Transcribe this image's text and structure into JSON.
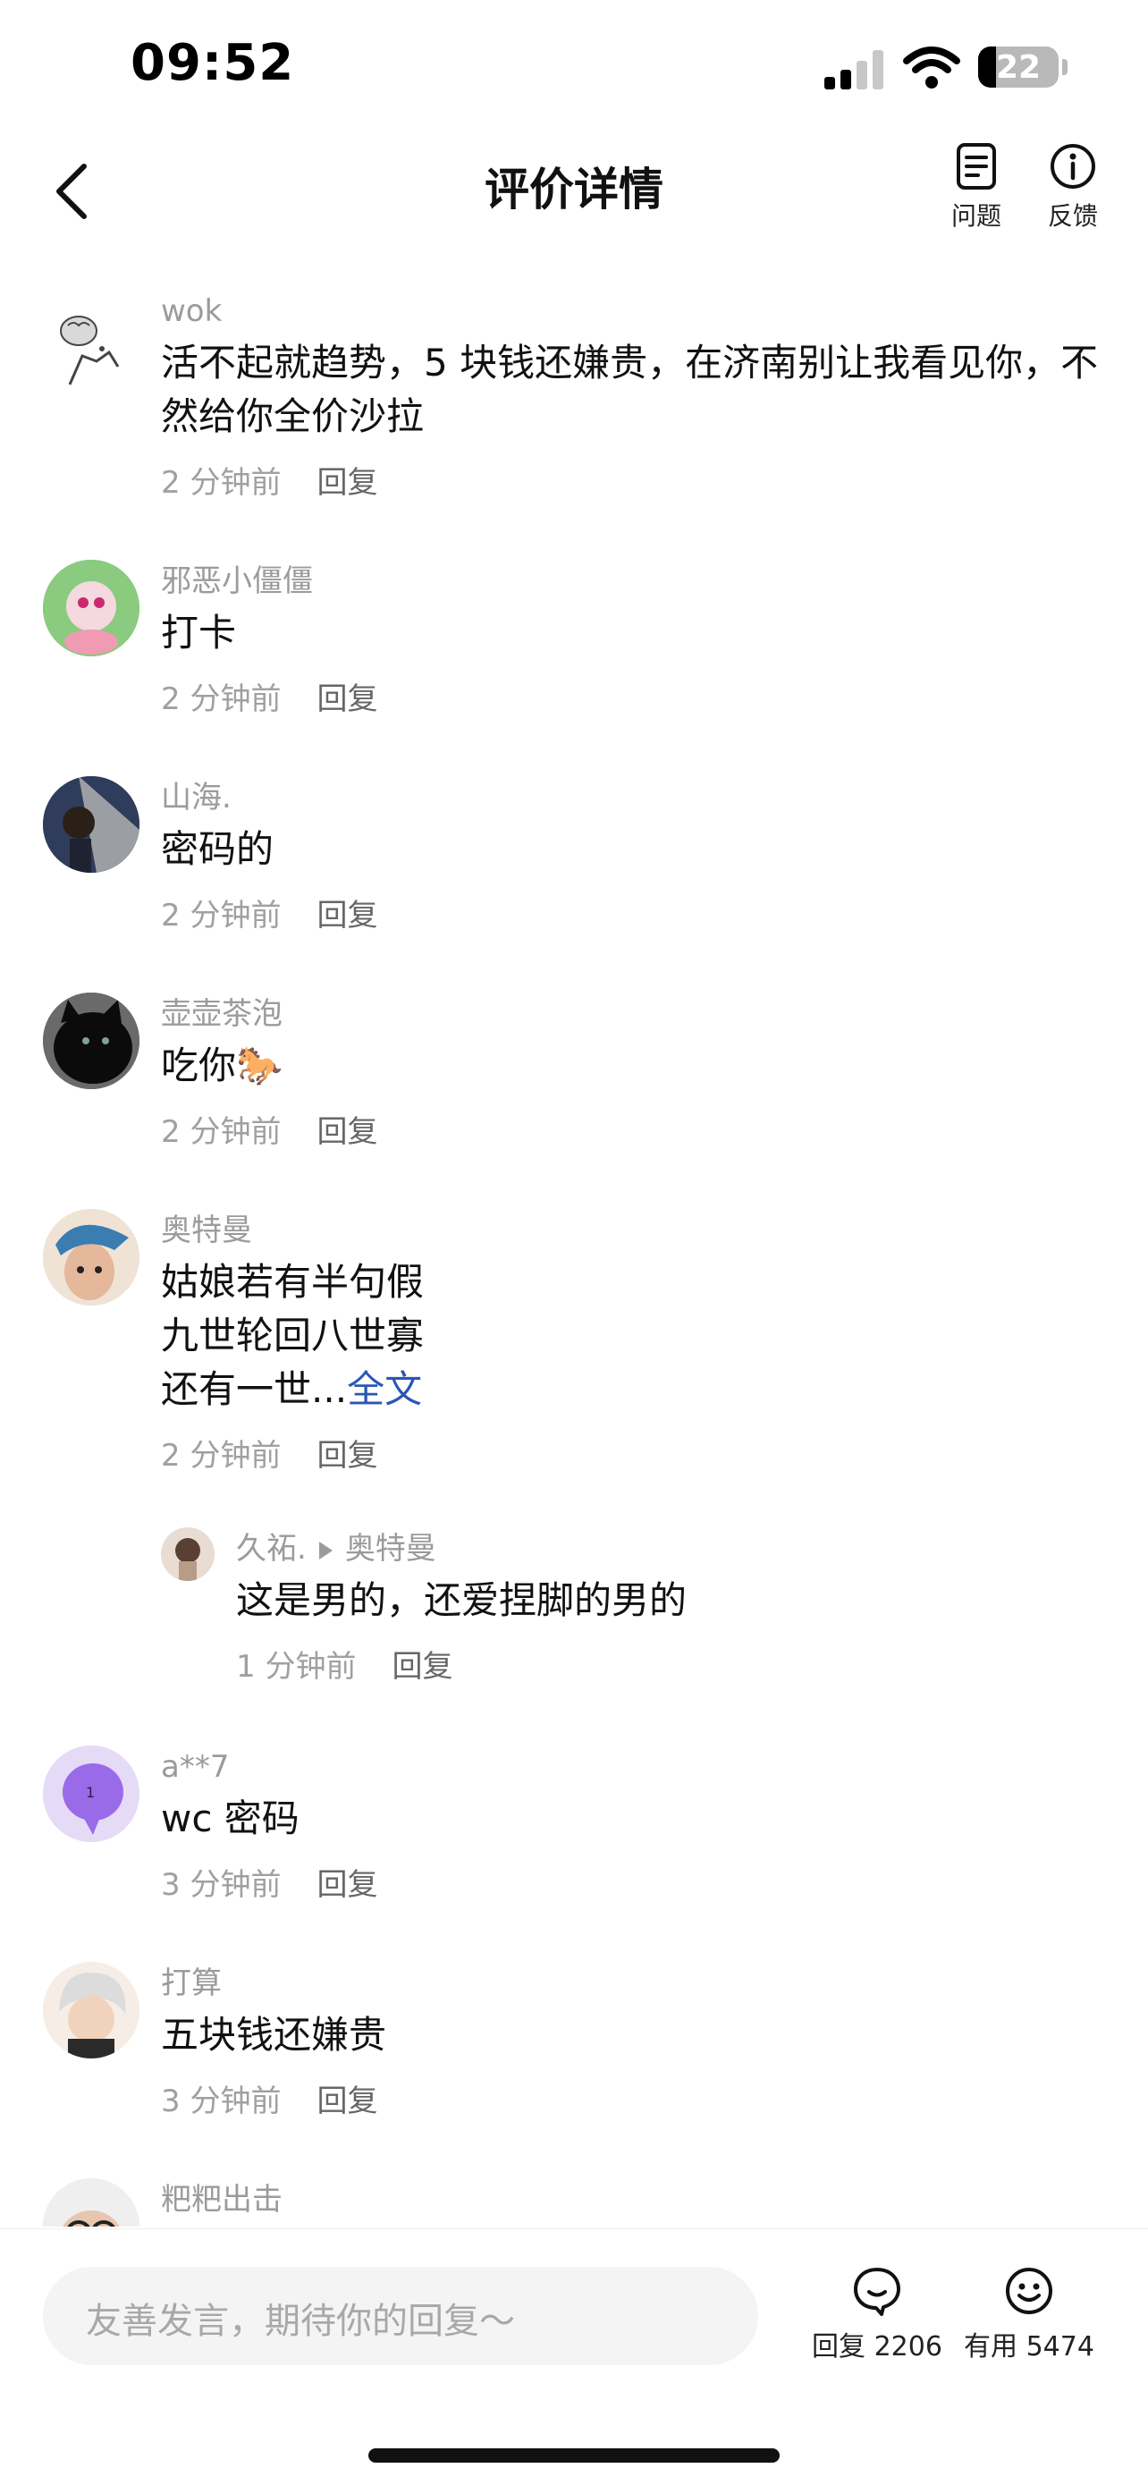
{
  "status_bar": {
    "time": "09:52",
    "battery": "22",
    "battery_level_percent": 22
  },
  "nav": {
    "title": "评价详情",
    "back_icon": "chevron-left-icon",
    "actions": [
      {
        "label": "问题",
        "icon": "document-icon"
      },
      {
        "label": "反馈",
        "icon": "info-icon"
      }
    ]
  },
  "comments": [
    {
      "user": "wok",
      "text": "活不起就趋势，5 块钱还嫌贵，在济南别让我看见你，不然给你全价沙拉",
      "time": "2 分钟前",
      "reply_label": "回复"
    },
    {
      "user": "邪恶小僵僵",
      "text": "打卡",
      "time": "2 分钟前",
      "reply_label": "回复"
    },
    {
      "user": "山海.",
      "text": "密码的",
      "time": "2 分钟前",
      "reply_label": "回复"
    },
    {
      "user": "壶壶茶泡",
      "text": "吃你🐎",
      "time": "2 分钟前",
      "reply_label": "回复"
    },
    {
      "user": "奥特曼",
      "lines": [
        "姑娘若有半句假",
        "九世轮回八世寡",
        "还有一世..."
      ],
      "more_label": "全文",
      "time": "2 分钟前",
      "reply_label": "回复",
      "sub_reply": {
        "user": "久祏.",
        "reply_to": "奥特曼",
        "text": "这是男的，还爱捏脚的男的",
        "time": "1 分钟前",
        "reply_label": "回复"
      }
    },
    {
      "user": "a**7",
      "text": "wc 密码",
      "time": "3 分钟前",
      "reply_label": "回复"
    },
    {
      "user": "打算",
      "text": "五块钱还嫌贵",
      "time": "3 分钟前",
      "reply_label": "回复"
    },
    {
      "user": "粑粑出击",
      "text": "",
      "time": "",
      "reply_label": ""
    }
  ],
  "bottom_bar": {
    "input_placeholder": "友善发言，期待你的回复～",
    "reply_label": "回复 2206",
    "useful_label": "有用 5474"
  },
  "colors": {
    "link": "#2a56b4",
    "secondary_text": "#9b9b9b",
    "input_bg": "#f4f4f4"
  }
}
